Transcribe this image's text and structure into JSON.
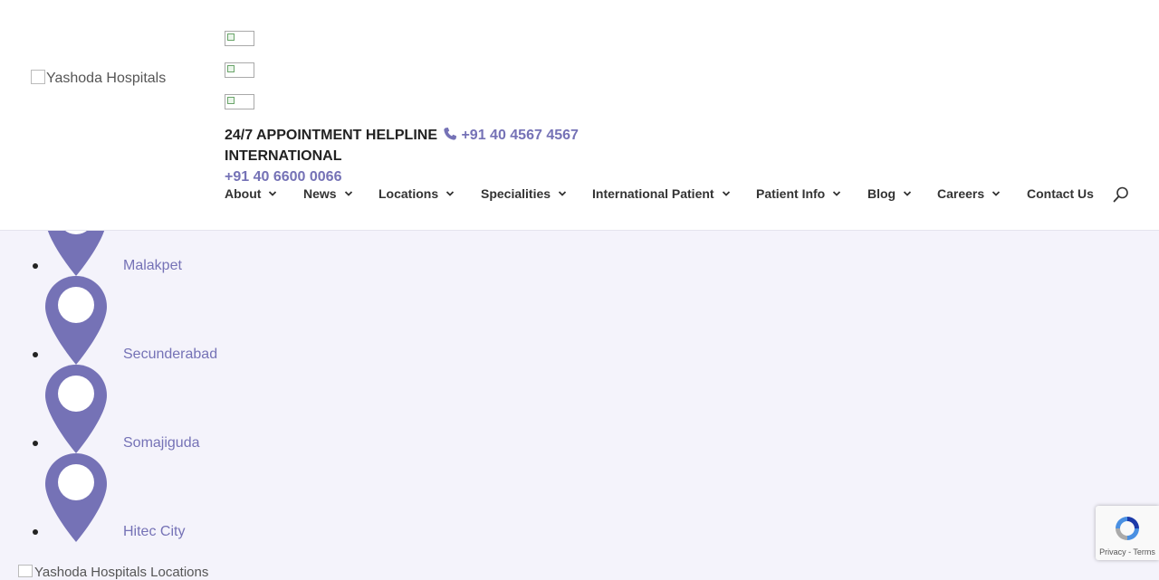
{
  "header": {
    "logo_alt": "Yashoda Hospitals",
    "helpline_label": "24/7 APPOINTMENT HELPLINE",
    "helpline_phone": "+91 40 4567 4567",
    "international_label": "INTERNATIONAL",
    "international_phone": "+91 40 6600 0066"
  },
  "nav": {
    "items": [
      {
        "label": "About"
      },
      {
        "label": "News"
      },
      {
        "label": "Locations"
      },
      {
        "label": "Specialities"
      },
      {
        "label": "International Patient"
      },
      {
        "label": "Patient Info"
      },
      {
        "label": "Blog"
      },
      {
        "label": "Careers"
      },
      {
        "label": "Contact Us"
      }
    ]
  },
  "locations": [
    {
      "name": "Malakpet"
    },
    {
      "name": "Secunderabad"
    },
    {
      "name": "Somajiguda"
    },
    {
      "name": "Hitec City"
    }
  ],
  "bottom_image_alt": "Yashoda Hospitals Locations",
  "recaptcha": {
    "terms": "Privacy - Terms"
  },
  "colors": {
    "accent": "#7572b6",
    "background": "#f4f3fb"
  }
}
